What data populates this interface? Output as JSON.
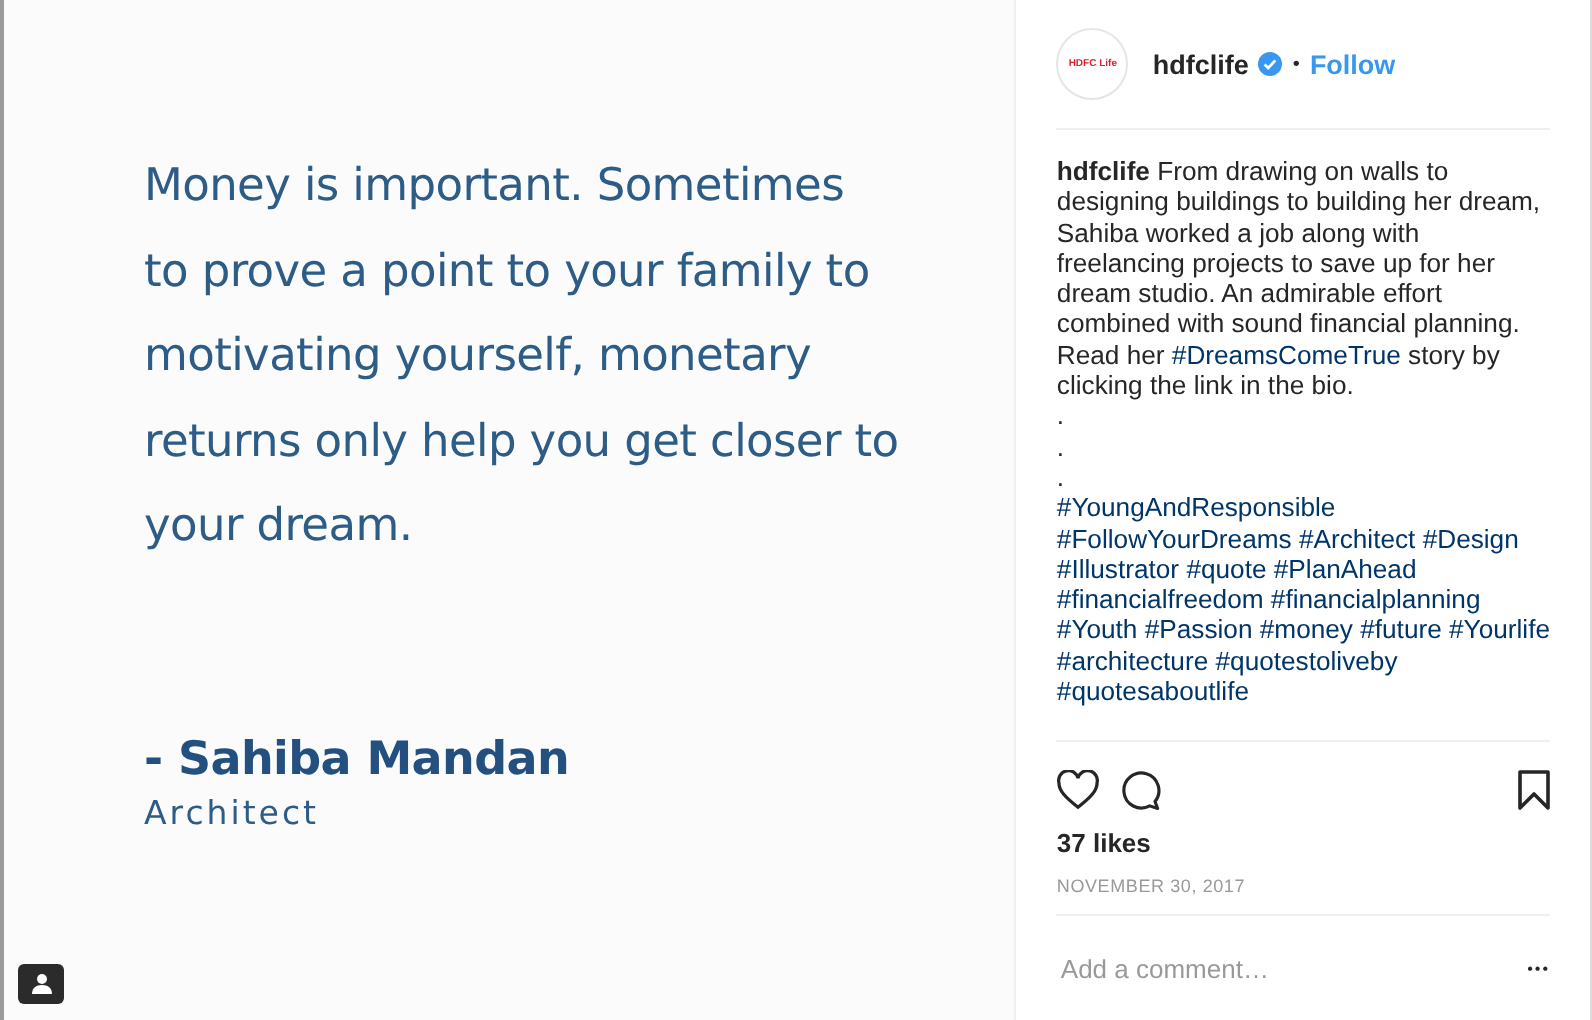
{
  "post_image": {
    "quote": "Money is important. Sometimes to prove a point to your family to motivating yourself, monetary returns only help you get closer to your dream.",
    "author": "- Sahiba Mandan",
    "role": "Architect"
  },
  "header": {
    "avatar_text": "HDFC Life",
    "username": "hdfclife",
    "verified": true,
    "separator": "•",
    "follow": "Follow"
  },
  "caption": {
    "username": "hdfclife",
    "segments": [
      {
        "kind": "text",
        "text": "From drawing on walls to designing buildings to building her dream, Sahiba worked a job along with freelancing projects to save up for her dream studio. An admirable effort combined with sound financial planning. Read her"
      },
      {
        "kind": "tag",
        "text": "#DreamsComeTrue"
      },
      {
        "kind": "text",
        "text": "story by clicking the link in the bio."
      }
    ],
    "dots": [
      ".",
      ".",
      "."
    ],
    "hashtag_lines": [
      [
        "#YoungAndResponsible"
      ],
      [
        "#FollowYourDreams",
        "#Architect",
        "#Design"
      ],
      [
        "#Illustrator",
        "#quote",
        "#PlanAhead"
      ],
      [
        "#financialfreedom",
        "#financialplanning"
      ],
      [
        "#Youth",
        "#Passion",
        "#money",
        "#future",
        "#Yourlife"
      ],
      [
        "#architecture",
        "#quotestoliveby"
      ],
      [
        "#quotesaboutlife"
      ]
    ]
  },
  "actions": {
    "liked": false,
    "saved": false
  },
  "likes": "37 likes",
  "date": "NOVEMBER 30, 2017",
  "comment": {
    "placeholder": "Add a comment…",
    "more": "•••"
  }
}
